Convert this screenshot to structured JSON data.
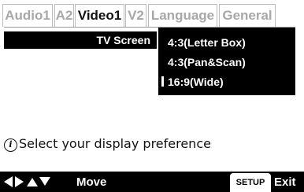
{
  "tabs": [
    {
      "label": "Audio1",
      "active": false
    },
    {
      "label": "A2",
      "active": false
    },
    {
      "label": "Video1",
      "active": true
    },
    {
      "label": "V2",
      "active": false
    },
    {
      "label": "Language",
      "active": false
    },
    {
      "label": "General",
      "active": false
    }
  ],
  "setting": {
    "label": "TV Screen",
    "options": [
      "4:3(Letter Box)",
      "4:3(Pan&Scan)",
      "16:9(Wide)"
    ],
    "selected": "16:9(Wide)"
  },
  "info": {
    "icon": "info-icon",
    "text": "Select your display preference"
  },
  "footer": {
    "nav_icons": [
      "left-arrow-icon",
      "right-arrow-icon",
      "up-arrow-icon",
      "down-arrow-icon"
    ],
    "move_label": "Move",
    "setup_label": "SETUP",
    "exit_label": "Exit"
  }
}
